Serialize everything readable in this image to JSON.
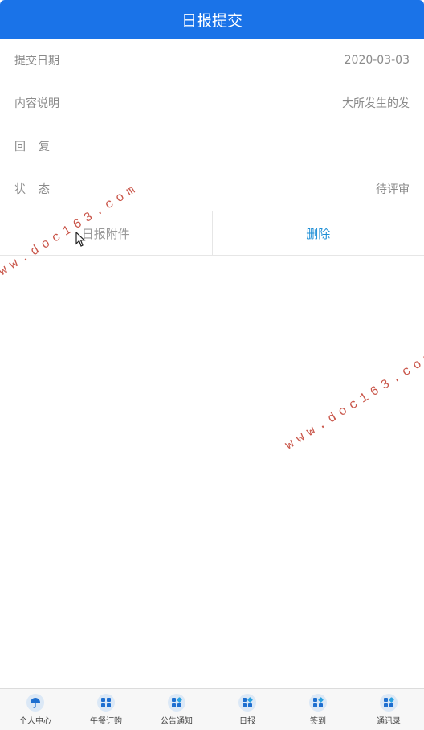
{
  "header": {
    "title": "日报提交"
  },
  "rows": [
    {
      "label": "提交日期",
      "value": "2020-03-03"
    },
    {
      "label": "内容说明",
      "value": "大所发生的发"
    },
    {
      "label": "回复",
      "value": ""
    },
    {
      "label": "状态",
      "value": "待评审"
    }
  ],
  "actions": {
    "attachment_label": "日报附件",
    "delete_label": "删除"
  },
  "watermark": "www.doc163.com",
  "tabbar": {
    "items": [
      {
        "label": "个人中心",
        "icon": "umbrella-icon"
      },
      {
        "label": "午餐订购",
        "icon": "grid-icon"
      },
      {
        "label": "公告通知",
        "icon": "grid-icon"
      },
      {
        "label": "日报",
        "icon": "grid-icon"
      },
      {
        "label": "签到",
        "icon": "grid-icon"
      },
      {
        "label": "通讯录",
        "icon": "grid-icon"
      }
    ]
  },
  "colors": {
    "primary": "#1a73e8",
    "delete": "#1f8fd6",
    "watermark": "#c0392b"
  }
}
